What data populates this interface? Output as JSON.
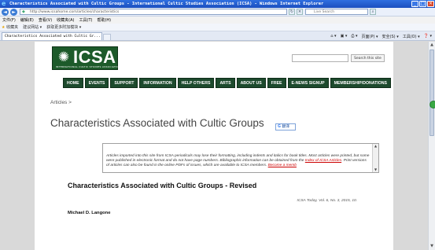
{
  "window": {
    "title": "Characteristics Associated with Cultic Groups - International Cultic Studies Association (ICSA) - Windows Internet Explorer",
    "min": "_",
    "max": "□",
    "close": "×"
  },
  "address_bar": {
    "back": "◄",
    "forward": "►",
    "url": "http://www.icsahome.com/articles/characteristics",
    "search_placeholder": "Live Search"
  },
  "menu": [
    "文件(F)",
    "编辑(E)",
    "查看(V)",
    "收藏夹(A)",
    "工具(T)",
    "帮助(H)"
  ],
  "favorites_bar": {
    "favorites_label": "收藏夹",
    "items": [
      "建议网站 ▾",
      "获取更多附加模块 ▾"
    ]
  },
  "tab": {
    "label": "Characteristics Associated with Cultic Gr..."
  },
  "command_bar": {
    "items": [
      "页面(P) ▾",
      "安全(S) ▾",
      "工具(O) ▾",
      "❓ ▾"
    ]
  },
  "site": {
    "logo_text": "ICSA",
    "logo_sub": "INTERNATIONAL CULTIC STUDIES ASSOCIATION",
    "search_button": "Search this site",
    "nav": [
      "HOME",
      "EVENTS",
      "SUPPORT",
      "INFORMATION",
      "HELP OTHERS",
      "ARTS",
      "ABOUT US",
      "FREE",
      "E-NEWS SIGNUP",
      "MEMBERSHIP/DONATIONS"
    ],
    "breadcrumb": "Articles >",
    "page_title": "Characteristics Associated with Cultic Groups",
    "notice": {
      "text_part1": "Articles imported into this site from ICSA periodicals may lose their formatting, including indents and italics for book titles. Most articles were printed, but some were published in electronic format and do not have page numbers. Bibliographic information can be obtained from the",
      "link1": "Index of ICSA Articles",
      "text_part2": ". Print versions of articles can also be found in the online PDFs of issues, which are available to ICSA members.",
      "link2": "Become a memb",
      "translate_label": "翻译"
    },
    "article_heading": "Characteristics Associated with Cultic Groups - Revised",
    "citation": "ICSA Today, Vol. 6, No. 3, 2015, 10.",
    "author": "Michael D. Langone"
  }
}
